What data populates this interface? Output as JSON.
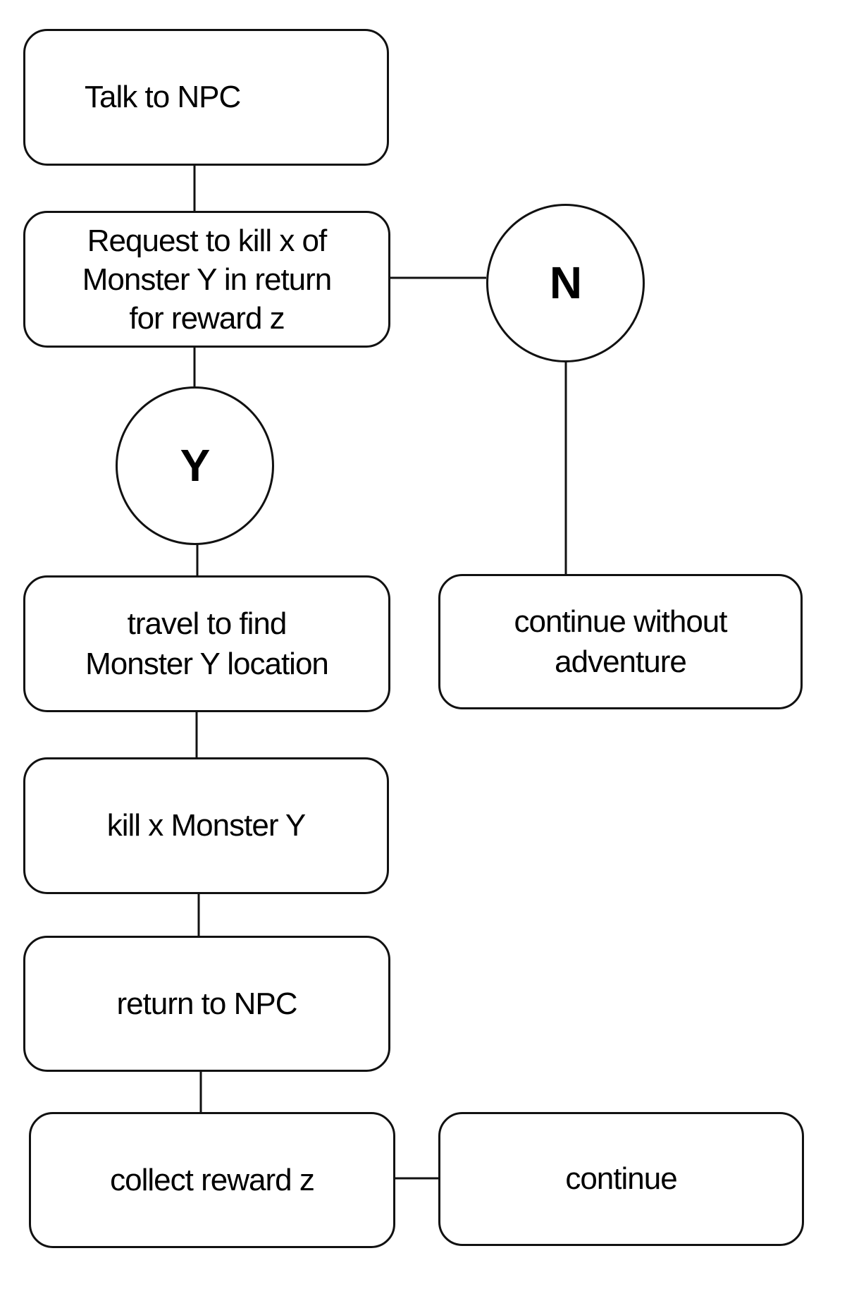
{
  "diagram": {
    "nodes": {
      "talk": "Talk to NPC",
      "request": "Request to kill x of\nMonster Y in return\nfor reward z",
      "no": "N",
      "yes": "Y",
      "travel": "travel to find\nMonster Y location",
      "continue_without": "continue without\nadventure",
      "kill": "kill x Monster Y",
      "return": "return to NPC",
      "collect": "collect reward z",
      "continue": "continue"
    },
    "edges": [
      [
        "talk",
        "request"
      ],
      [
        "request",
        "no"
      ],
      [
        "request",
        "yes"
      ],
      [
        "no",
        "continue_without"
      ],
      [
        "yes",
        "travel"
      ],
      [
        "travel",
        "kill"
      ],
      [
        "kill",
        "return"
      ],
      [
        "return",
        "collect"
      ],
      [
        "collect",
        "continue"
      ]
    ]
  }
}
